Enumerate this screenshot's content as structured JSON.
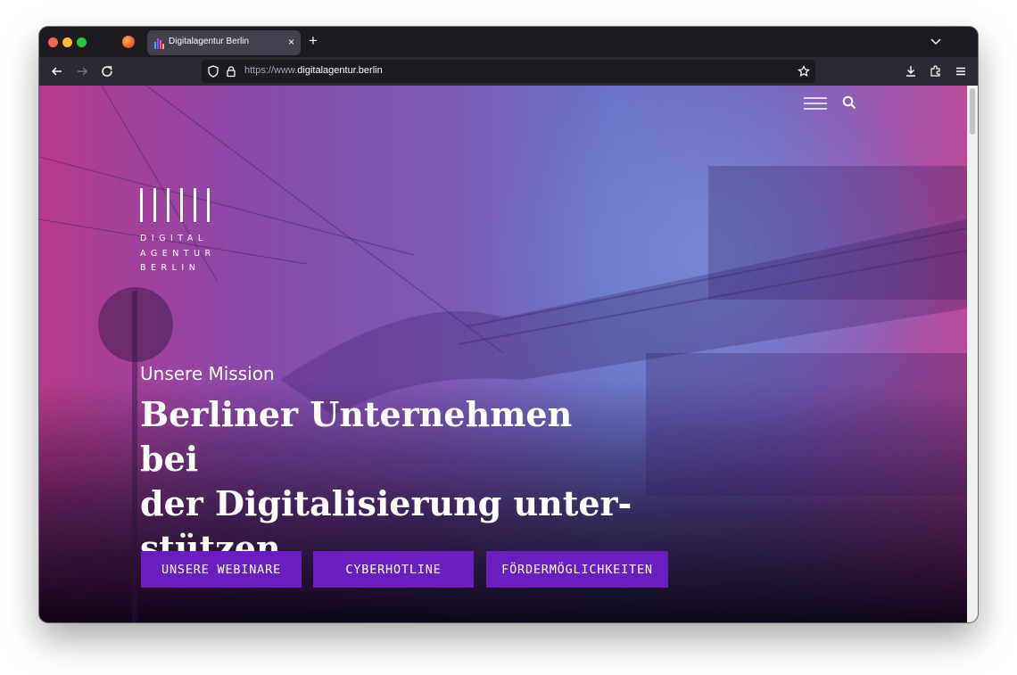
{
  "browser": {
    "tab_title": "Digitalagentur Berlin",
    "tab_close": "×",
    "new_tab": "+",
    "url_prefix": "https://www.",
    "url_domain": "digitalagentur.berlin"
  },
  "page": {
    "logo_lines": [
      "DIGITAL",
      "AGENTUR",
      "BERLIN"
    ],
    "mission_label": "Unsere Mission",
    "headline_lines": [
      "Berliner Unternehmen bei",
      "der Digitalisierung unter-",
      "stützen."
    ],
    "buttons": [
      "UNSERE WEBINARE",
      "CYBERHOTLINE",
      "FÖRDERMÖGLICHKEITEN"
    ]
  },
  "colors": {
    "cta": "#6a1ec0",
    "chrome_dark": "#1c1b22",
    "chrome_toolbar": "#2b2a33",
    "tab_active": "#42414d"
  }
}
